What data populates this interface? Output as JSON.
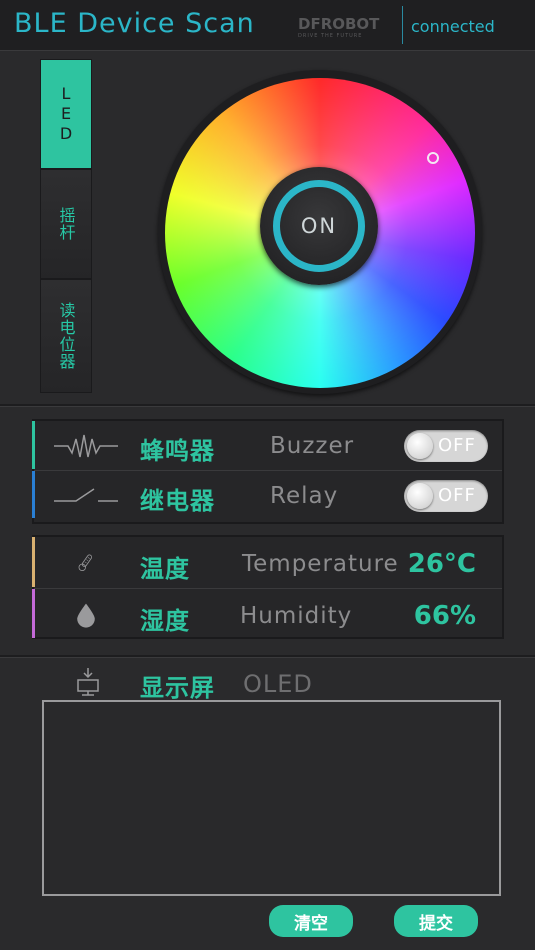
{
  "header": {
    "title": "BLE Device Scan",
    "brand": "DFROBOT",
    "brand_tagline": "DRIVE THE FUTURE",
    "status": "connected"
  },
  "tabs": [
    {
      "label": "LED",
      "active": true
    },
    {
      "label": "摇杆",
      "active": false
    },
    {
      "label": "读电位器",
      "active": false
    }
  ],
  "led": {
    "power_label": "ON"
  },
  "actuators": [
    {
      "name_zh": "蜂鸣器",
      "name_en": "Buzzer",
      "state": "OFF",
      "icon": "buzzer-waveform-icon",
      "accent": "#2ec4a0"
    },
    {
      "name_zh": "继电器",
      "name_en": "Relay",
      "state": "OFF",
      "icon": "relay-switch-icon",
      "accent": "#2a7fd4"
    }
  ],
  "sensors": [
    {
      "name_zh": "温度",
      "name_en": "Temperature",
      "value": "26°C",
      "icon": "thermometer-icon",
      "accent": "#d8b070"
    },
    {
      "name_zh": "湿度",
      "name_en": "Humidity",
      "value": "66%",
      "icon": "water-drop-icon",
      "accent": "#c46ad8"
    }
  ],
  "oled": {
    "name_zh": "显示屏",
    "name_en": "OLED",
    "icon": "display-icon",
    "text": ""
  },
  "buttons": {
    "clear": "清空",
    "submit": "提交"
  },
  "colors": {
    "accent": "#2ec4a0",
    "title": "#2bb6c8",
    "background": "#2a2a2c"
  }
}
